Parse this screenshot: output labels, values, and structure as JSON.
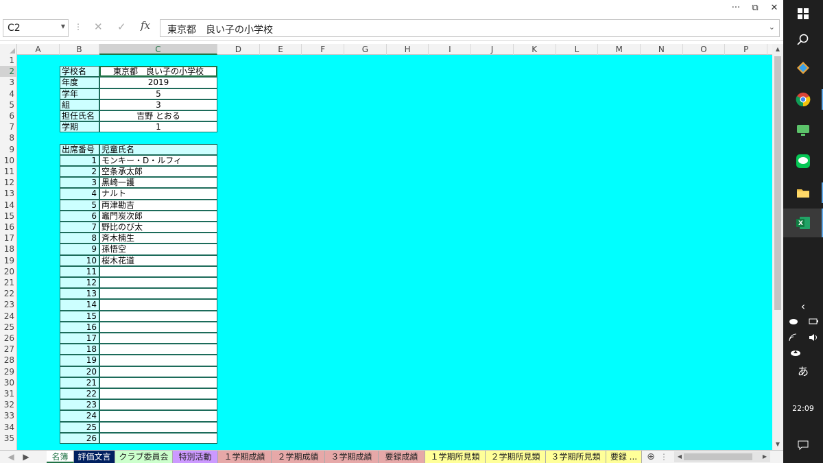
{
  "window": {
    "more_label": "···",
    "restore_label": "⧉",
    "close_label": "✕"
  },
  "formula_bar": {
    "name_box": "C2",
    "formula": "東京都　良い子の小学校",
    "cancel_glyph": "✕",
    "enter_glyph": "✓",
    "fx_label": "fx"
  },
  "columns": [
    "A",
    "B",
    "C",
    "D",
    "E",
    "F",
    "G",
    "H",
    "I",
    "J",
    "K",
    "L",
    "M",
    "N",
    "O",
    "P"
  ],
  "rows": [
    "1",
    "2",
    "3",
    "4",
    "5",
    "6",
    "7",
    "8",
    "9",
    "10",
    "11",
    "12",
    "13",
    "14",
    "15",
    "16",
    "17",
    "18",
    "19",
    "20",
    "21",
    "22",
    "23",
    "24",
    "25",
    "26",
    "27",
    "28",
    "29",
    "30",
    "31",
    "32",
    "33",
    "34",
    "35"
  ],
  "school_info": [
    {
      "label": "学校名",
      "value": "東京都　良い子の小学校"
    },
    {
      "label": "年度",
      "value": "2019"
    },
    {
      "label": "学年",
      "value": "5"
    },
    {
      "label": "組",
      "value": "3"
    },
    {
      "label": "担任氏名",
      "value": "吉野 とおる"
    },
    {
      "label": "学期",
      "value": "1"
    }
  ],
  "roster": {
    "headers": [
      "出席番号",
      "児童氏名"
    ],
    "rows": [
      {
        "no": "1",
        "name": "モンキー・D・ルフィ"
      },
      {
        "no": "2",
        "name": "空条承太郎"
      },
      {
        "no": "3",
        "name": "黒崎一護"
      },
      {
        "no": "4",
        "name": "ナルト"
      },
      {
        "no": "5",
        "name": "両津勘吉"
      },
      {
        "no": "6",
        "name": "竈門炭次郎"
      },
      {
        "no": "7",
        "name": "野比のび太"
      },
      {
        "no": "8",
        "name": "斉木楠生"
      },
      {
        "no": "9",
        "name": "孫悟空"
      },
      {
        "no": "10",
        "name": "桜木花道"
      },
      {
        "no": "11",
        "name": ""
      },
      {
        "no": "12",
        "name": ""
      },
      {
        "no": "13",
        "name": ""
      },
      {
        "no": "14",
        "name": ""
      },
      {
        "no": "15",
        "name": ""
      },
      {
        "no": "16",
        "name": ""
      },
      {
        "no": "17",
        "name": ""
      },
      {
        "no": "18",
        "name": ""
      },
      {
        "no": "19",
        "name": ""
      },
      {
        "no": "20",
        "name": ""
      },
      {
        "no": "21",
        "name": ""
      },
      {
        "no": "22",
        "name": ""
      },
      {
        "no": "23",
        "name": ""
      },
      {
        "no": "24",
        "name": ""
      },
      {
        "no": "25",
        "name": ""
      },
      {
        "no": "26",
        "name": ""
      }
    ]
  },
  "sheet_tabs": [
    {
      "label": "名簿",
      "color": "#ffffff",
      "text": "#217346"
    },
    {
      "label": "評価文言",
      "color": "#002060",
      "text": "#ffffff"
    },
    {
      "label": "クラブ委員会",
      "color": "#ccffcc",
      "text": "#222222"
    },
    {
      "label": "特別活動",
      "color": "#cc99ff",
      "text": "#222222"
    },
    {
      "label": "１学期成績",
      "color": "#e6a8a8",
      "text": "#222222"
    },
    {
      "label": "２学期成績",
      "color": "#e6a8a8",
      "text": "#222222"
    },
    {
      "label": "３学期成績",
      "color": "#e6a8a8",
      "text": "#222222"
    },
    {
      "label": "要録成績",
      "color": "#e6a8a8",
      "text": "#222222"
    },
    {
      "label": "１学期所見類",
      "color": "#ffff99",
      "text": "#222222"
    },
    {
      "label": "２学期所見類",
      "color": "#ffff99",
      "text": "#222222"
    },
    {
      "label": "３学期所見類",
      "color": "#ffff99",
      "text": "#222222"
    },
    {
      "label": "要録 ...",
      "color": "#ffff99",
      "text": "#222222"
    }
  ],
  "sheet_nav": {
    "prev": "◀",
    "next": "▶",
    "add": "⊕",
    "more": "⋮"
  },
  "taskbar": {
    "time": "22:09",
    "ime": "あ",
    "icons": [
      "windows-icon",
      "search-icon",
      "app-icon",
      "chrome-icon",
      "remote-icon",
      "line-icon",
      "folder-icon",
      "excel-icon"
    ]
  },
  "colors": {
    "sheet_bg": "#00ffff",
    "label_bg": "#ccffff",
    "border": "#1c6b5a",
    "accent": "#217346"
  }
}
